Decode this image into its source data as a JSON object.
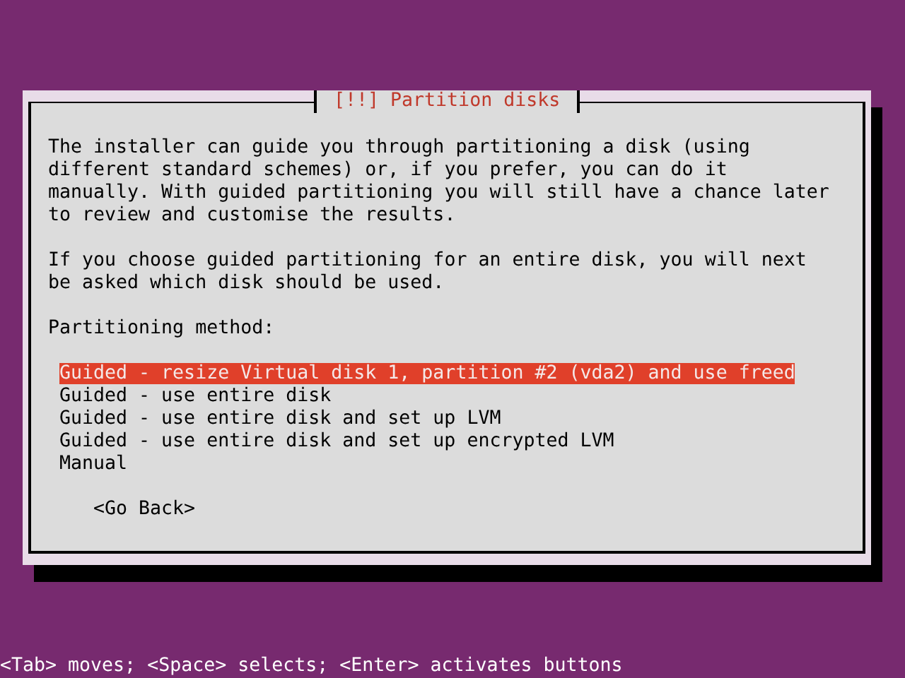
{
  "dialog": {
    "title": "[!!] Partition disks",
    "paragraphs": [
      "The installer can guide you through partitioning a disk (using\ndifferent standard schemes) or, if you prefer, you can do it\nmanually. With guided partitioning you will still have a chance later\nto review and customise the results.",
      "If you choose guided partitioning for an entire disk, you will next\nbe asked which disk should be used."
    ],
    "prompt": "Partitioning method:",
    "options": [
      {
        "label": "Guided - resize Virtual disk 1, partition #2 (vda2) and use freed",
        "selected": true
      },
      {
        "label": "Guided - use entire disk",
        "selected": false
      },
      {
        "label": "Guided - use entire disk and set up LVM",
        "selected": false
      },
      {
        "label": "Guided - use entire disk and set up encrypted LVM",
        "selected": false
      },
      {
        "label": "Manual",
        "selected": false
      }
    ],
    "buttons": [
      "<Go Back>"
    ]
  },
  "status_bar": "<Tab> moves; <Space> selects; <Enter> activates buttons"
}
